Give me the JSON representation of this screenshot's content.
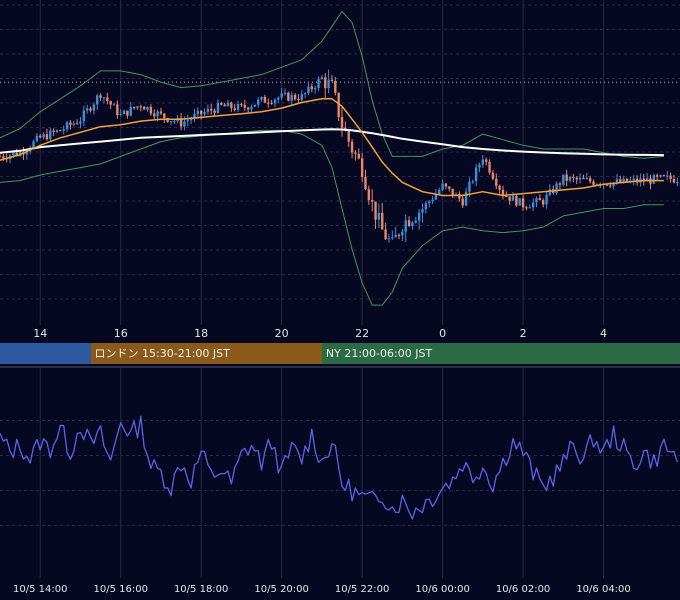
{
  "colors": {
    "background": "#060822",
    "grid": "#262a48",
    "candle_up": "#3a8fd6",
    "candle_down": "#e8866e",
    "bollinger": "#3c9a5c",
    "ma_fast": "#f2a23a",
    "ma_slow": "#ffffff",
    "oscillator": "#5b63e8",
    "price_line": "#bfc3d6",
    "session_tokyo": "#2d5aa0",
    "session_london": "#8a5a1a",
    "session_ny": "#2a6a44"
  },
  "price_axis": {
    "labels": [
      "14",
      "16",
      "18",
      "20",
      "22",
      "0",
      "2",
      "4"
    ]
  },
  "sessions": [
    {
      "label": ""
    },
    {
      "label": "ロンドン 15:30-21:00 JST"
    },
    {
      "label": "NY 21:00-06:00 JST"
    }
  ],
  "oscillator_axis": {
    "labels": [
      "10/5 14:00",
      "10/5 16:00",
      "10/5 18:00",
      "10/5 20:00",
      "10/5 22:00",
      "10/6 00:00",
      "10/6 02:00",
      "10/6 04:00"
    ]
  },
  "chart_data": [
    {
      "type": "candlestick",
      "title": "",
      "xlabel": "",
      "ylabel": "",
      "x_hours": [
        13,
        13.5,
        14,
        14.5,
        15,
        15.5,
        16,
        16.5,
        17,
        17.5,
        18,
        18.5,
        19,
        19.5,
        20,
        20.5,
        21,
        21.25,
        21.5,
        21.75,
        22,
        22.25,
        22.5,
        22.75,
        23,
        23.5,
        24,
        24.5,
        25,
        25.5,
        26,
        26.5,
        27,
        27.5,
        28,
        28.5,
        29,
        29.5
      ],
      "close": [
        18,
        20,
        28,
        32,
        38,
        52,
        40,
        46,
        40,
        36,
        41,
        45,
        44,
        48,
        50,
        50,
        60,
        55,
        35,
        22,
        12,
        -8,
        -22,
        -30,
        -18,
        -10,
        2,
        -6,
        18,
        -2,
        -8,
        -6,
        6,
        5,
        4,
        4,
        5,
        6
      ],
      "series": [
        {
          "name": "",
          "values": [
            16,
            19,
            24,
            28,
            31,
            34,
            35,
            37,
            38,
            38,
            39,
            40,
            41,
            42,
            44,
            47,
            49,
            49,
            45,
            38,
            31,
            23,
            15,
            9,
            4,
            -1,
            -3,
            -3,
            -1,
            -3,
            -2,
            -1,
            0,
            1,
            3,
            4,
            5,
            5
          ]
        },
        {
          "name": "",
          "values": [
            20,
            21,
            23,
            24,
            25,
            26,
            27,
            28,
            28.5,
            29,
            29.5,
            30,
            30.5,
            31,
            31.5,
            32,
            32.5,
            32.6,
            32.5,
            32,
            31.3,
            30.5,
            29.5,
            28.5,
            27.5,
            26,
            24.5,
            23,
            22,
            21.2,
            20.6,
            20.1,
            19.7,
            19.4,
            19.1,
            18.9,
            18.8,
            18.7
          ]
        }
      ],
      "bollinger_upper": [
        28,
        33,
        42,
        49,
        56,
        64,
        64,
        62,
        58,
        55,
        56,
        58,
        60,
        62,
        66,
        70,
        80,
        88,
        96,
        90,
        72,
        48,
        30,
        18,
        18,
        18,
        22,
        24,
        30,
        27,
        24,
        22,
        22,
        22,
        20,
        18,
        17,
        18
      ],
      "bollinger_lower": [
        4,
        5,
        8,
        10,
        12,
        14,
        18,
        22,
        26,
        28,
        29,
        30,
        31,
        32,
        32,
        30,
        24,
        12,
        -10,
        -32,
        -50,
        -62,
        -62,
        -55,
        -42,
        -30,
        -22,
        -20,
        -22,
        -23,
        -22,
        -20,
        -14,
        -12,
        -10,
        -10,
        -8,
        -8
      ],
      "horizontal_line": 58,
      "ylim": [
        -70,
        100
      ]
    },
    {
      "type": "line",
      "title": "",
      "xlabel": "",
      "ylabel": "",
      "x_hours": [
        13,
        13.25,
        13.5,
        13.75,
        14,
        14.25,
        14.5,
        14.75,
        15,
        15.25,
        15.5,
        15.75,
        16,
        16.25,
        16.5,
        16.75,
        17,
        17.25,
        17.5,
        17.75,
        18,
        18.25,
        18.5,
        18.75,
        19,
        19.25,
        19.5,
        19.75,
        20,
        20.25,
        20.5,
        20.75,
        21,
        21.25,
        21.5,
        21.75,
        22,
        22.25,
        22.5,
        22.75,
        23,
        23.25,
        23.5,
        23.75,
        24,
        24.25,
        24.5,
        24.75,
        25,
        25.25,
        25.5,
        25.75,
        26,
        26.25,
        26.5,
        26.75,
        27,
        27.25,
        27.5,
        27.75,
        28,
        28.25,
        28.5,
        28.75,
        29,
        29.25,
        29.5,
        29.75
      ],
      "series": [
        {
          "name": "",
          "values": [
            0.5,
            0.1,
            0.3,
            -0.1,
            0.4,
            0.2,
            0.8,
            0.1,
            0.9,
            0.3,
            0.6,
            -0.2,
            1.0,
            0.6,
            0.9,
            -0.3,
            -0.5,
            -0.9,
            -0.2,
            -0.7,
            0.1,
            -0.6,
            -0.4,
            -0.8,
            0.0,
            0.3,
            -0.2,
            0.4,
            -0.5,
            0.2,
            -0.1,
            0.6,
            -0.2,
            0.4,
            -0.8,
            -1.0,
            -1.2,
            -1.3,
            -1.1,
            -1.5,
            -1.3,
            -1.6,
            -1.4,
            -1.2,
            -0.9,
            -0.7,
            -0.2,
            -0.6,
            -0.3,
            -0.8,
            -0.2,
            0.4,
            0.1,
            -0.5,
            -0.9,
            -0.6,
            -0.2,
            0.3,
            -0.1,
            0.5,
            0.1,
            0.6,
            0.2,
            -0.3,
            0.1,
            -0.2,
            0.3,
            0.0
          ]
        }
      ],
      "gridlines": [
        1,
        0,
        -1,
        -2
      ],
      "ylim": [
        -3.5,
        2.5
      ]
    }
  ]
}
